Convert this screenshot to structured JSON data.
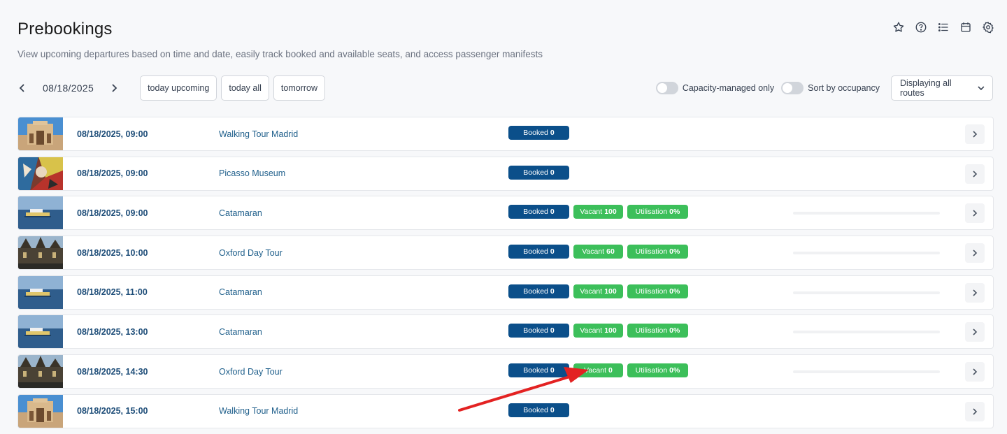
{
  "page": {
    "title": "Prebookings",
    "subtitle": "View upcoming departures based on time and date, easily track booked and available seats, and access passenger manifests"
  },
  "top_icons": [
    "star-icon",
    "help-icon",
    "list-icon",
    "calendar-icon",
    "gear-icon"
  ],
  "toolbar": {
    "date": "08/18/2025",
    "quick_filters": [
      "today upcoming",
      "today all",
      "tomorrow"
    ],
    "toggle_capacity": "Capacity-managed only",
    "toggle_sort": "Sort by occupancy",
    "route_select": "Displaying all routes"
  },
  "colors": {
    "booked": "#0b4f8a",
    "vacant": "#3cbf5a",
    "annotation_arrow": "#e32222"
  },
  "rows": [
    {
      "datetime": "08/18/2025, 09:00",
      "route": "Walking Tour Madrid",
      "thumb": "madrid",
      "booked_label": "Booked",
      "booked": "0"
    },
    {
      "datetime": "08/18/2025, 09:00",
      "route": "Picasso Museum",
      "thumb": "picasso",
      "booked_label": "Booked",
      "booked": "0"
    },
    {
      "datetime": "08/18/2025, 09:00",
      "route": "Catamaran",
      "thumb": "catamaran",
      "booked_label": "Booked",
      "booked": "0",
      "vacant_label": "Vacant",
      "vacant": "100",
      "util_label": "Utilisation",
      "util": "0%"
    },
    {
      "datetime": "08/18/2025, 10:00",
      "route": "Oxford Day Tour",
      "thumb": "oxford",
      "booked_label": "Booked",
      "booked": "0",
      "vacant_label": "Vacant",
      "vacant": "60",
      "util_label": "Utilisation",
      "util": "0%"
    },
    {
      "datetime": "08/18/2025, 11:00",
      "route": "Catamaran",
      "thumb": "catamaran",
      "booked_label": "Booked",
      "booked": "0",
      "vacant_label": "Vacant",
      "vacant": "100",
      "util_label": "Utilisation",
      "util": "0%"
    },
    {
      "datetime": "08/18/2025, 13:00",
      "route": "Catamaran",
      "thumb": "catamaran",
      "booked_label": "Booked",
      "booked": "0",
      "vacant_label": "Vacant",
      "vacant": "100",
      "util_label": "Utilisation",
      "util": "0%"
    },
    {
      "datetime": "08/18/2025, 14:30",
      "route": "Oxford Day Tour",
      "thumb": "oxford",
      "booked_label": "Booked",
      "booked": "0",
      "vacant_label": "Vacant",
      "vacant": "0",
      "util_label": "Utilisation",
      "util": "0%"
    },
    {
      "datetime": "08/18/2025, 15:00",
      "route": "Walking Tour Madrid",
      "thumb": "madrid",
      "booked_label": "Booked",
      "booked": "0"
    }
  ]
}
